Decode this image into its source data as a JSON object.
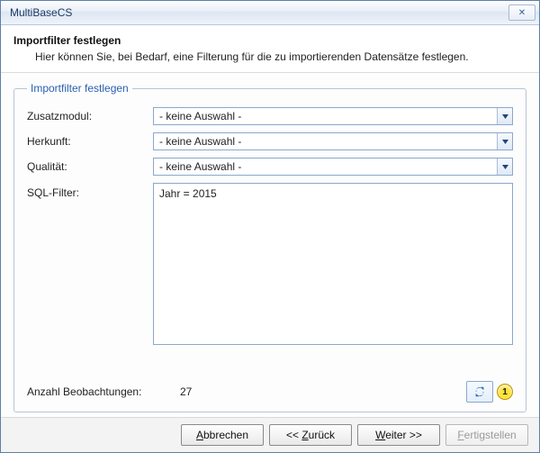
{
  "window": {
    "title": "MultiBaseCS",
    "close_glyph": "✕"
  },
  "header": {
    "heading": "Importfilter festlegen",
    "subheading": "Hier können Sie, bei Bedarf, eine Filterung für die zu importierenden Datensätze festlegen."
  },
  "group": {
    "legend": "Importfilter festlegen"
  },
  "labels": {
    "zusatzmodul": "Zusatzmodul:",
    "herkunft": "Herkunft:",
    "qualitaet": "Qualität:",
    "sqlfilter": "SQL-Filter:",
    "anzahl": "Anzahl Beobachtungen:"
  },
  "values": {
    "zusatzmodul": "- keine Auswahl -",
    "herkunft": "- keine Auswahl -",
    "qualitaet": "- keine Auswahl -",
    "sql": "Jahr = 2015",
    "anzahl": "27"
  },
  "callout": {
    "index": "1"
  },
  "buttons": {
    "cancel_pre": "",
    "cancel_ul": "A",
    "cancel_post": "bbrechen",
    "back": "<< ",
    "back_ul": "Z",
    "back_post": "urück",
    "next_ul": "W",
    "next_post": "eiter >>",
    "finish_ul": "F",
    "finish_post": "ertigstellen"
  }
}
